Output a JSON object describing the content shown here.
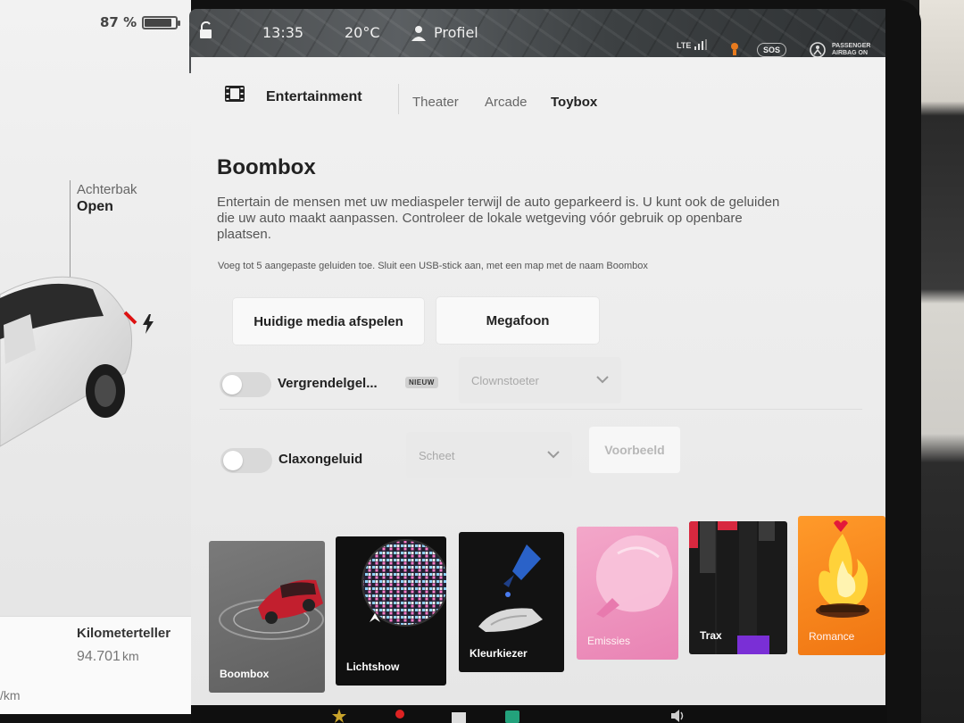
{
  "status": {
    "battery_percent_text": "87 %",
    "battery_level": 0.87,
    "time": "13:35",
    "temperature": "20°C",
    "profile_label": "Profiel",
    "network": "LTE",
    "sos_label": "SOS",
    "airbag_text_line1": "PASSENGER",
    "airbag_text_line2": "AIRBAG ON"
  },
  "vehicle": {
    "trunk_label": "Achterbak",
    "trunk_state": "Open",
    "odometer_label": "Kilometerteller",
    "odometer_value": "94.701",
    "odometer_unit": "km",
    "partial_unit": "/km"
  },
  "header": {
    "section_title": "Entertainment",
    "tabs": [
      {
        "label": "Theater",
        "active": false
      },
      {
        "label": "Arcade",
        "active": false
      },
      {
        "label": "Toybox",
        "active": true
      }
    ]
  },
  "boombox": {
    "title": "Boombox",
    "description": "Entertain de mensen met uw mediaspeler terwijl de auto geparkeerd is. U kunt ook de geluiden die uw auto maakt aanpassen. Controleer de lokale wetgeving vóór gebruik op openbare plaatsen.",
    "hint": "Voeg tot 5 aangepaste geluiden toe. Sluit een USB-stick aan, met een map met de naam Boombox",
    "play_media_button": "Huidige media afspelen",
    "megaphone_button": "Megafoon",
    "lock_sound_label": "Vergrendelgel...",
    "new_badge": "NIEUW",
    "lock_sound_value": "Clownstoeter",
    "horn_label": "Claxongeluid",
    "horn_value": "Scheet",
    "preview_button": "Voorbeeld"
  },
  "tiles": [
    {
      "label": "Boombox"
    },
    {
      "label": "Lichtshow"
    },
    {
      "label": "Kleurkiezer"
    },
    {
      "label": "Emissies"
    },
    {
      "label": "Trax"
    },
    {
      "label": "Romance"
    }
  ],
  "colors": {
    "accent_red": "#e3193a",
    "trax_purple": "#7a2fd6",
    "romance_orange": "#f58a1f",
    "emissions_pink": "#ee95bf"
  }
}
